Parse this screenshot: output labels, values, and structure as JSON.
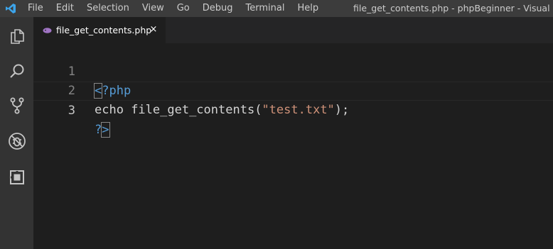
{
  "titlebar": {
    "app_icon": "vscode-logo-icon",
    "menu": [
      "File",
      "Edit",
      "Selection",
      "View",
      "Go",
      "Debug",
      "Terminal",
      "Help"
    ],
    "window_title": "file_get_contents.php - phpBeginner - Visual Studio C"
  },
  "activity_bar": {
    "items": [
      "explorer-icon",
      "search-icon",
      "source-control-icon",
      "debug-icon",
      "extensions-icon"
    ]
  },
  "tabs": [
    {
      "label": "file_get_contents.php",
      "icon": "php-file-icon",
      "close": "×"
    }
  ],
  "editor": {
    "lines": [
      {
        "num": "1",
        "parts": [
          {
            "t": "<",
            "c": "tag",
            "box": true
          },
          {
            "t": "?php",
            "c": "tag"
          }
        ]
      },
      {
        "num": "2",
        "parts": [
          {
            "t": "echo ",
            "c": "plain"
          },
          {
            "t": "file_get_contents",
            "c": "fn"
          },
          {
            "t": "(",
            "c": "plain"
          },
          {
            "t": "\"test.txt\"",
            "c": "str"
          },
          {
            "t": ");",
            "c": "plain"
          }
        ]
      },
      {
        "num": "3",
        "parts": [
          {
            "t": "?",
            "c": "tag"
          },
          {
            "t": ">",
            "c": "tag",
            "box": true
          }
        ]
      }
    ],
    "active_line": 3
  },
  "colors": {
    "titlebar_bg": "#3c3c3c",
    "activity_bg": "#333333",
    "editor_bg": "#1e1e1e",
    "tag": "#569cd6",
    "string": "#ce9178",
    "function": "#dcdcaa"
  }
}
